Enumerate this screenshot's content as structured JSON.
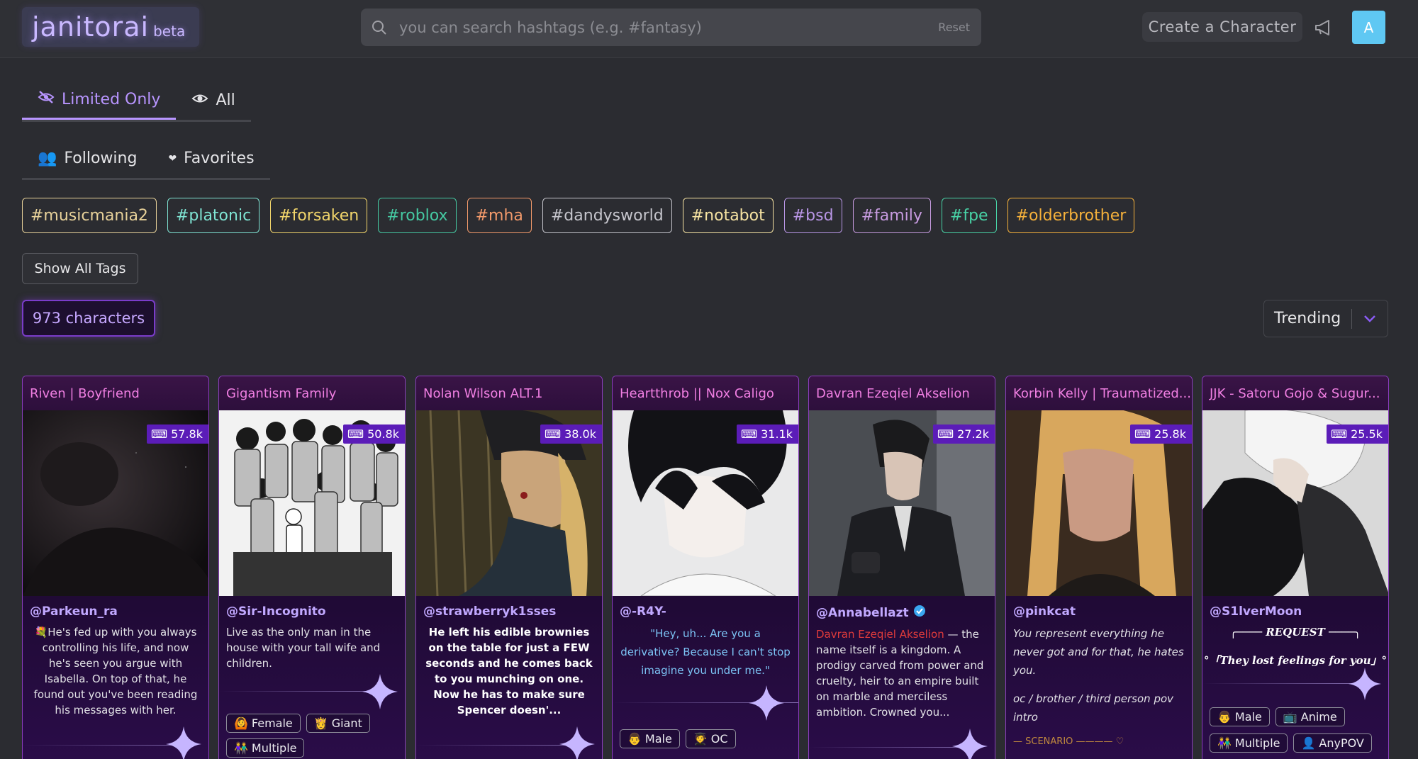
{
  "header": {
    "logo_main": "janitorai",
    "logo_beta": "beta",
    "search_placeholder": "you can search hashtags (e.g. #fantasy)",
    "reset_label": "Reset",
    "create_label": "Create a Character",
    "avatar_letter": "A"
  },
  "tabs_row1": [
    {
      "label": "Limited Only",
      "icon": "eye-slash-icon",
      "active": true
    },
    {
      "label": "All",
      "icon": "eye-icon",
      "active": false
    }
  ],
  "tabs_row2": [
    {
      "label": "Following",
      "icon": "people-icon"
    },
    {
      "label": "Favorites",
      "icon": "heart-icon"
    }
  ],
  "hashtags": [
    {
      "label": "#musicmania2",
      "color": "#e8d29a"
    },
    {
      "label": "#platonic",
      "color": "#7fe4d3"
    },
    {
      "label": "#forsaken",
      "color": "#f2d66b"
    },
    {
      "label": "#roblox",
      "color": "#45c9a2"
    },
    {
      "label": "#mha",
      "color": "#f39a6b"
    },
    {
      "label": "#dandysworld",
      "color": "#c5c5cc"
    },
    {
      "label": "#notabot",
      "color": "#f6e3a2"
    },
    {
      "label": "#bsd",
      "color": "#b996e6"
    },
    {
      "label": "#family",
      "color": "#c79be0"
    },
    {
      "label": "#fpe",
      "color": "#48d3a6"
    },
    {
      "label": "#olderbrother",
      "color": "#f5b13b"
    }
  ],
  "show_tags_label": "Show All Tags",
  "count_label": "973 characters",
  "sort_label": "Trending",
  "cards": [
    {
      "title": "Riven | Boyfriend",
      "chats": "57.8k",
      "creator": "@Parkeun_ra",
      "desc_lead": "💐",
      "desc": "He's fed up with you always controlling his life, and now he's seen you argue with Isabella. On top of that, he found out you've been reading his messages with her."
    },
    {
      "title": "Gigantism Family",
      "chats": "50.8k",
      "creator": "@Sir-Incognito",
      "desc": "Live as the only man in the house with your tall wife and children.",
      "tags": [
        {
          "icon": "🙆",
          "label": "Female"
        },
        {
          "icon": "👸",
          "label": "Giant"
        },
        {
          "icon": "👫",
          "label": "Multiple"
        }
      ]
    },
    {
      "title": "Nolan Wilson ALT.1",
      "chats": "38.0k",
      "creator": "@strawberryk1sses",
      "desc": "He left his edible brownies on the table for just a FEW seconds and he comes back to you munching on one. Now he has to make sure Spencer doesn'..."
    },
    {
      "title": "Heartthrob || Nox Caligo",
      "chats": "31.1k",
      "creator": "@-R4Y-",
      "desc": "\"Hey, uh... Are you a derivative? Because I can't stop imagine you under me.\"",
      "tags": [
        {
          "icon": "👨",
          "label": "Male"
        },
        {
          "icon": "🧑‍🎓",
          "label": "OC"
        }
      ]
    },
    {
      "title": "Davran Ezeqiel Akselion",
      "chats": "27.2k",
      "creator": "@Annabellazt",
      "desc_red": "Davran Ezeqiel Akselion",
      "desc": " — the name itself is a kingdom. A prodigy carved from power and cruelty, heir to an empire built on marble and merciless ambition. Crowned you..."
    },
    {
      "title": "Korbin Kelly | Traumatized...",
      "chats": "25.8k",
      "creator": "@pinkcat",
      "desc": "You represent everything he never got and for that, he hates you.",
      "desc2": "oc / brother / third person pov intro",
      "scenario": "— SCENARIO ———— ♡"
    },
    {
      "title": "JJK - Satoru Gojo & Sugur...",
      "chats": "25.5k",
      "creator": "@S1lverMoon",
      "request": "╭──── REQUEST ────╮",
      "quote": "°「They lost feelings for you」°",
      "tags": [
        {
          "icon": "👨",
          "label": "Male"
        },
        {
          "icon": "📺",
          "label": "Anime"
        },
        {
          "icon": "👫",
          "label": "Multiple"
        },
        {
          "icon": "👤",
          "label": "AnyPOV"
        }
      ]
    }
  ]
}
